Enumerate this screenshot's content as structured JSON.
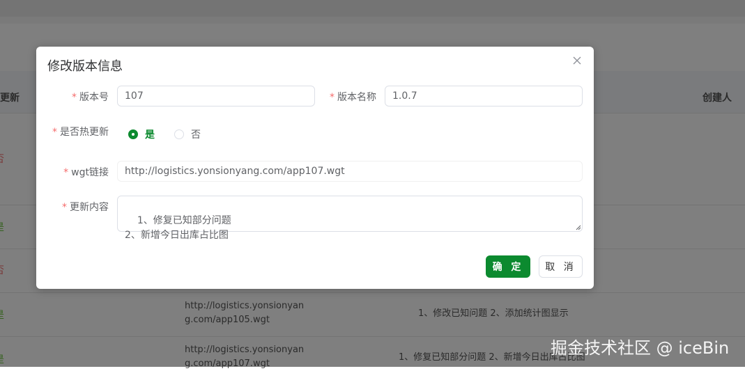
{
  "background": {
    "headers": {
      "hot_update_partial": "热更新",
      "creator": "创建人"
    },
    "rows": [
      {
        "tag": "否",
        "tag_color": "#f56c6c"
      },
      {
        "tag": "是",
        "tag_color": "#67c23a"
      },
      {
        "tag": "否",
        "tag_color": "#f56c6c"
      },
      {
        "tag": "是",
        "tag_color": "#67c23a",
        "link": "http://logistics.yonsionyan",
        "link2": "g.com/app105.wgt",
        "content": "1、修改已知问题 2、添加统计图显示"
      },
      {
        "tag": "是",
        "tag_color": "#67c23a",
        "link": "http://logistics.yonsionyan",
        "link2": "g.com/app107.wgt",
        "content": "1、修复已知部分问题 2、新增今日出库占比图"
      }
    ]
  },
  "dialog": {
    "title": "修改版本信息",
    "close_icon": "close-icon",
    "required_mark": "*",
    "fields": {
      "version_no": {
        "label": "版本号",
        "value": "107"
      },
      "version_name": {
        "label": "版本名称",
        "value": "1.0.7"
      },
      "hot_update": {
        "label": "是否热更新",
        "options": [
          "是",
          "否"
        ],
        "selected": "是"
      },
      "wgt_link": {
        "label": "wgt链接",
        "value": "http://logistics.yonsionyang.com/app107.wgt"
      },
      "update_content": {
        "label": "更新内容",
        "value": "1、修复已知部分问题\n2、新增今日出库占比图"
      }
    },
    "buttons": {
      "confirm": "确 定",
      "cancel": "取 消"
    }
  },
  "watermark": "掘金技术社区 @ iceBin",
  "colors": {
    "primary": "#0c8a2f",
    "required": "#f56c6c"
  }
}
